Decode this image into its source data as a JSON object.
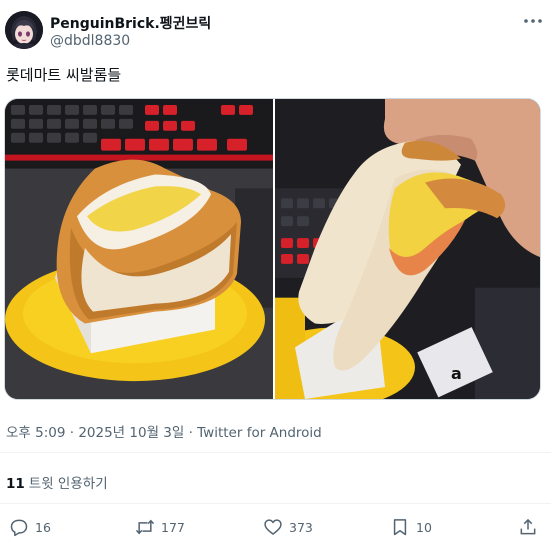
{
  "author": {
    "display_name": "PenguinBrick.펭귄브릭",
    "handle": "@dbdl8830",
    "avatar_icon": "anime-avatar-icon"
  },
  "tweet": {
    "text": "롯데마트 씨발롬들",
    "timestamp": "오후 5:09 · 2025년 10월 3일 · Twitter for Android",
    "quote_count": "11",
    "quote_label": "트윗 인용하기"
  },
  "media": {
    "photos": [
      {
        "description_icon": "sandwich-photo-left"
      },
      {
        "description_icon": "sandwich-photo-right"
      }
    ]
  },
  "actions": {
    "reply_count": "16",
    "retweet_count": "177",
    "like_count": "373",
    "bookmark_count": "10"
  },
  "colors": {
    "text_primary": "#0f1419",
    "text_secondary": "#536471",
    "divider": "#eff3f4"
  }
}
